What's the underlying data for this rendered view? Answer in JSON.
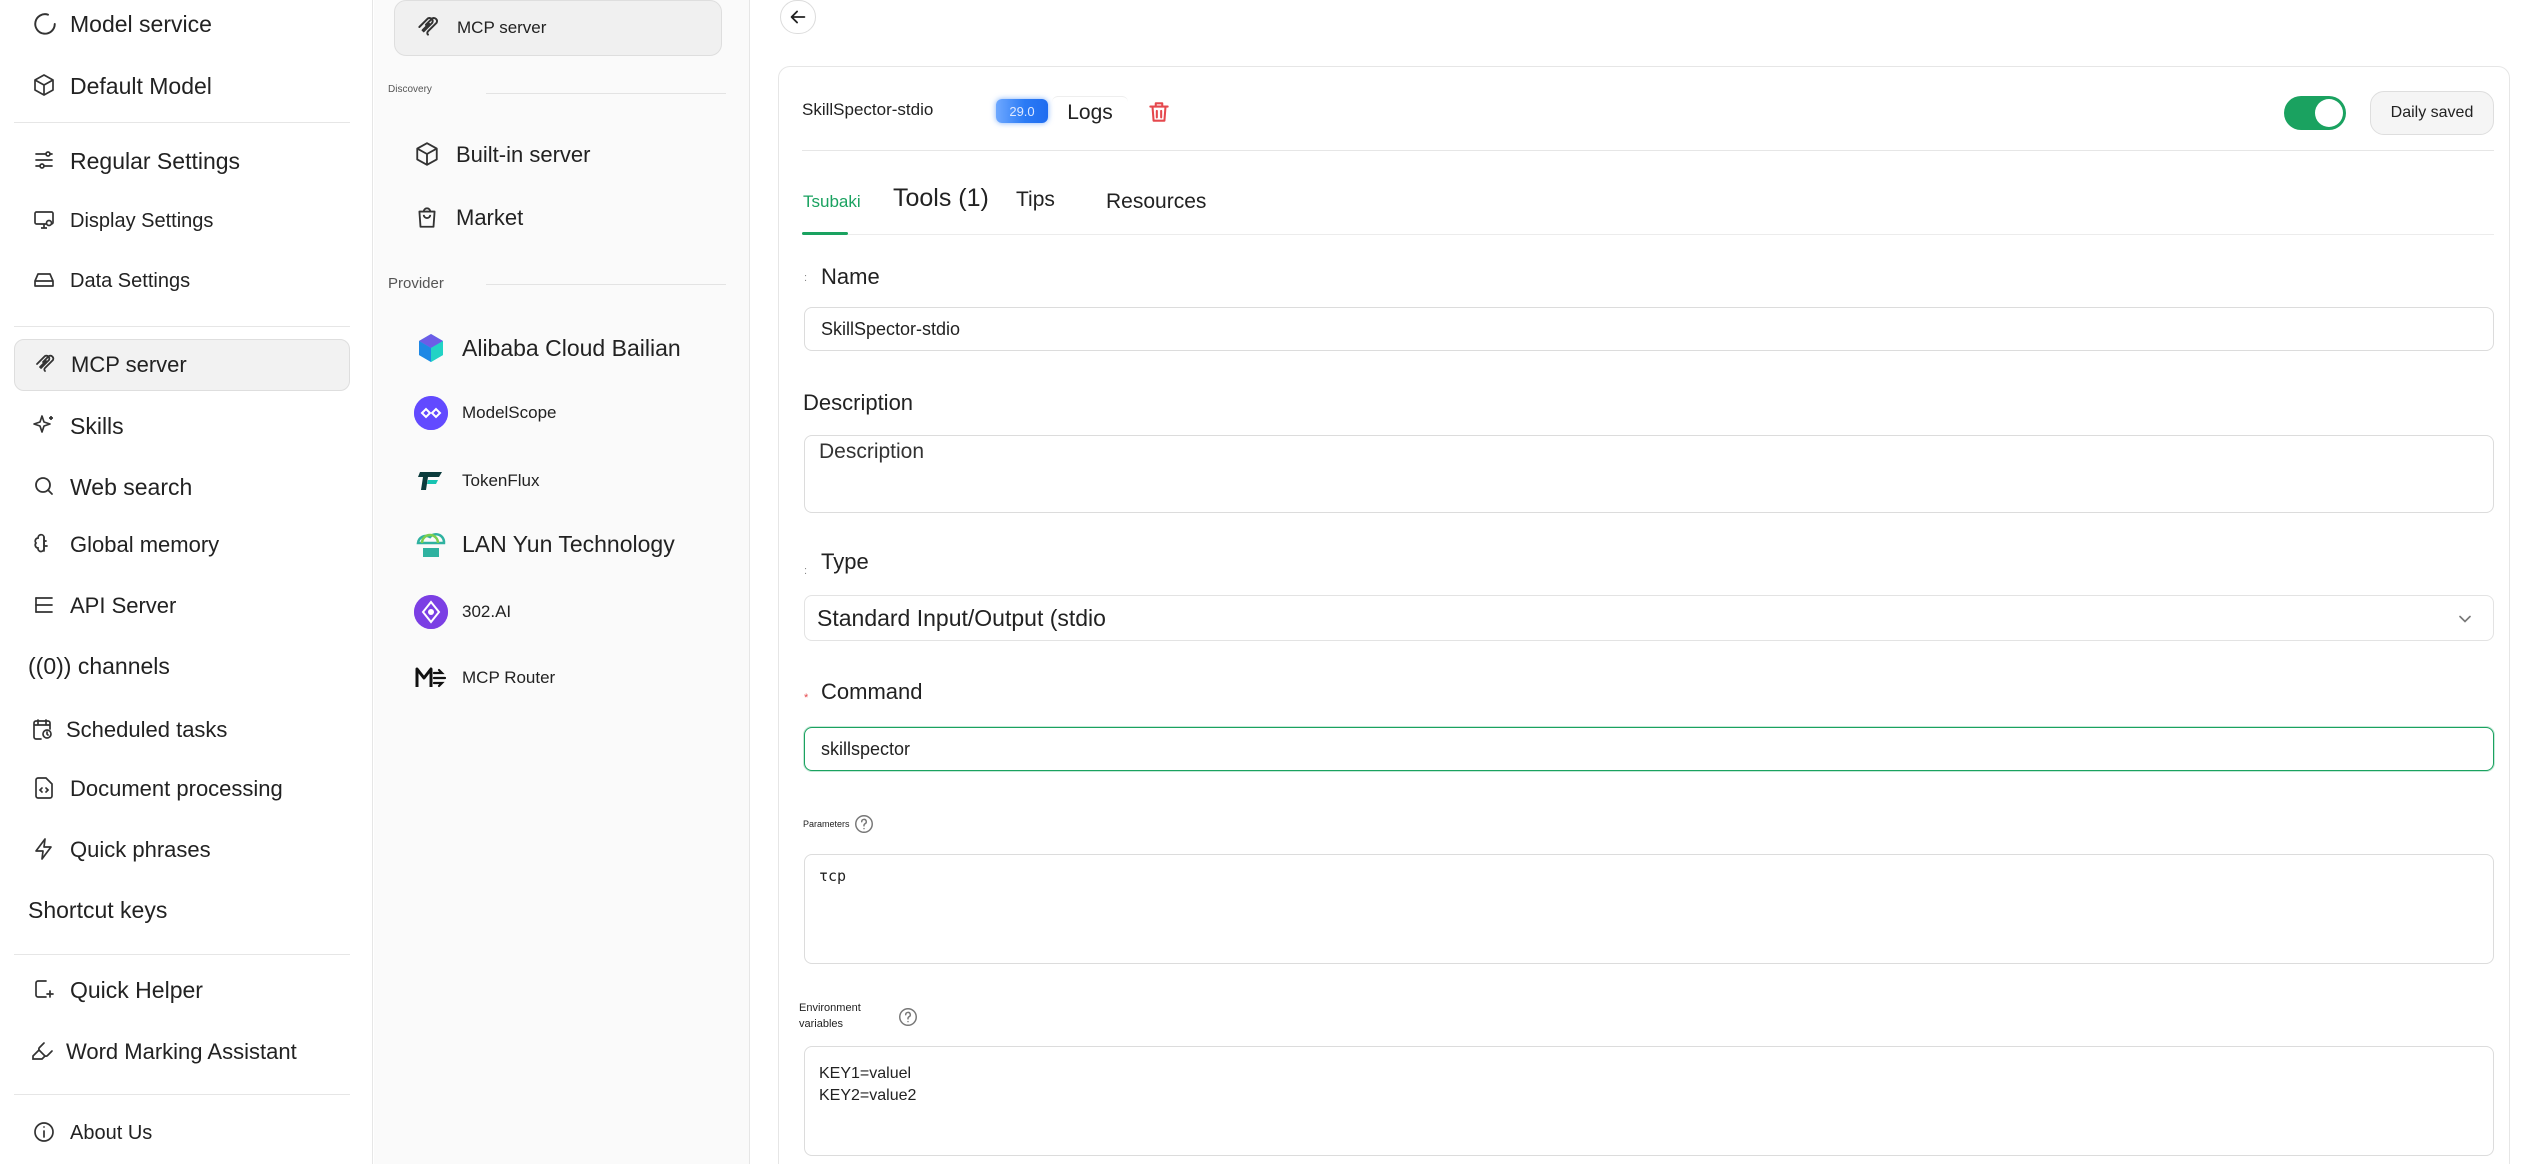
{
  "sidebar": {
    "items": [
      {
        "label": "Model service",
        "icon": "loading-arc-icon"
      },
      {
        "label": "Default Model",
        "icon": "cube-icon"
      },
      {
        "label": "Regular Settings",
        "icon": "sliders-icon"
      },
      {
        "label": "Display Settings",
        "icon": "monitor-icon"
      },
      {
        "label": "Data Settings",
        "icon": "hard-drive-icon"
      },
      {
        "label": "MCP server",
        "icon": "mcp-icon"
      },
      {
        "label": "Skills",
        "icon": "sparkles-icon"
      },
      {
        "label": "Web search",
        "icon": "search-icon"
      },
      {
        "label": "Global memory",
        "icon": "brain-icon"
      },
      {
        "label": "API Server",
        "icon": "server-icon"
      },
      {
        "label": "((0)) channels",
        "icon": ""
      },
      {
        "label": "Scheduled tasks",
        "icon": "calendar-clock-icon"
      },
      {
        "label": "Document processing",
        "icon": "file-code-icon"
      },
      {
        "label": "Quick phrases",
        "icon": "zap-icon"
      },
      {
        "label": "Shortcut keys",
        "icon": ""
      },
      {
        "label": "Quick Helper",
        "icon": "quick-helper-icon"
      },
      {
        "label": "Word Marking Assistant",
        "icon": "highlighter-icon"
      },
      {
        "label": "About Us",
        "icon": "info-icon"
      }
    ]
  },
  "mcp_panel": {
    "current": "MCP server",
    "discovery_label": "Discovery",
    "discovery_items": [
      {
        "label": "Built-in server",
        "icon": "cube-icon"
      },
      {
        "label": "Market",
        "icon": "shopping-bag-icon"
      }
    ],
    "provider_label": "Provider",
    "providers": [
      {
        "label": "Alibaba Cloud Bailian",
        "icon": "bailian-logo-icon"
      },
      {
        "label": "ModelScope",
        "icon": "modelscope-logo-icon"
      },
      {
        "label": "TokenFlux",
        "icon": "tokenflux-logo-icon"
      },
      {
        "label": "LAN Yun Technology",
        "icon": "lanyun-logo-icon"
      },
      {
        "label": "302.AI",
        "icon": "302ai-logo-icon"
      },
      {
        "label": "MCP Router",
        "icon": "mcp-router-logo-icon"
      }
    ]
  },
  "server": {
    "name": "SkillSpector-stdio",
    "version": "29.0",
    "logs_label": "Logs",
    "enabled": true,
    "saved_label": "Daily saved"
  },
  "tabs": [
    "Tsubaki",
    "Tools (1)",
    "Tips",
    "Resources"
  ],
  "form": {
    "name_label": "Name",
    "name_value": "SkillSpector-stdio",
    "description_label": "Description",
    "description_placeholder": "Description",
    "type_label": "Type",
    "type_value": "Standard Input/Output (stdio",
    "command_label": "Command",
    "command_value": "skillspector",
    "parameters_label": "Parameters",
    "parameters_value": "τcp",
    "env_label_line1": "Environment",
    "env_label_line2": "variables",
    "env_value": "KEY1=valuel\nKEY2=value2"
  },
  "colors": {
    "accent": "#1aa260",
    "danger": "#e5484d",
    "badge": "#2b7bf5"
  }
}
